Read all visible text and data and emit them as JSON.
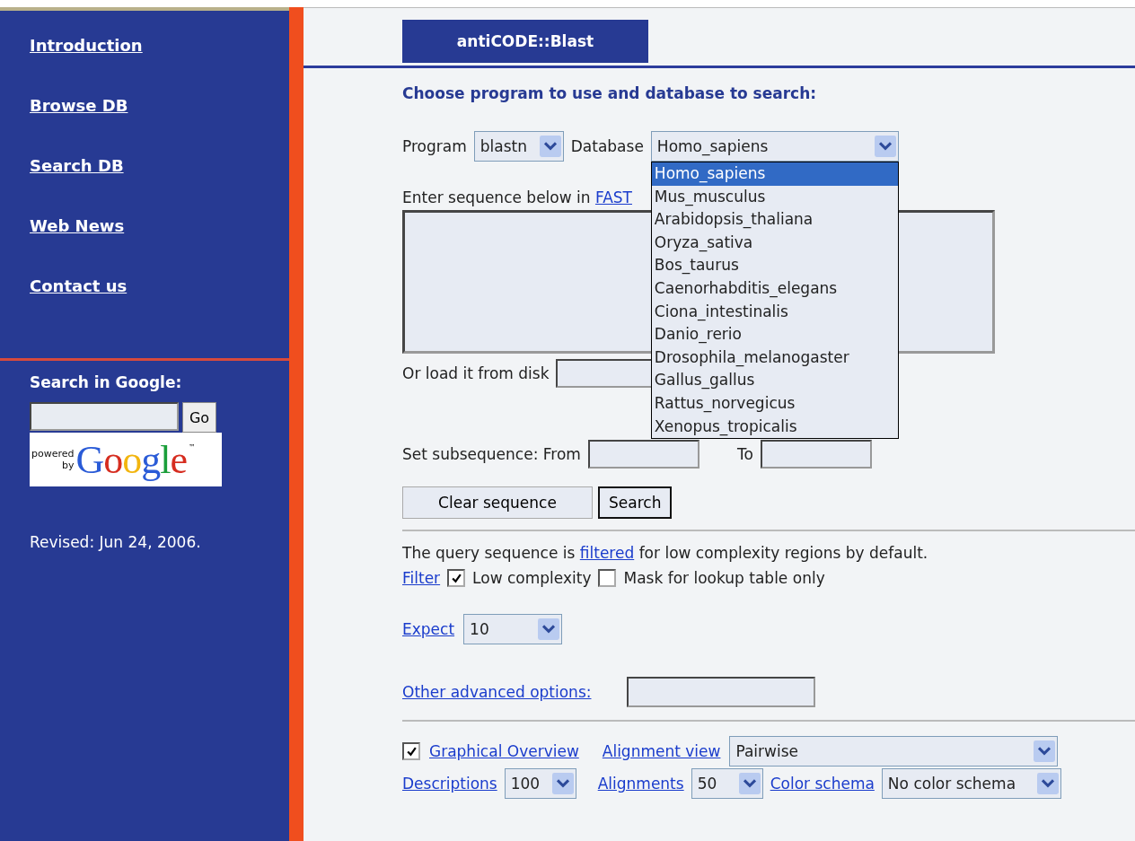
{
  "sidebar": {
    "nav_links": [
      "Introduction",
      "Browse DB",
      "Search DB",
      "Web News",
      "Contact us"
    ],
    "google": {
      "title": "Search in Google:",
      "button": "Go",
      "logo_small": [
        "powered",
        "by"
      ],
      "logo_word": "Google",
      "logo_mark": "™"
    },
    "revised": "Revised: Jun 24, 2006."
  },
  "tab": {
    "label": "antiCODE::Blast",
    "selected": true
  },
  "heading": "Choose program to use and database to search:",
  "program": {
    "label": "Program",
    "value": "blastn"
  },
  "database": {
    "label": "Database",
    "value": "Homo_sapiens",
    "expanded": true,
    "options": [
      {
        "label": "Homo_sapiens",
        "selected": true
      },
      {
        "label": "Mus_musculus",
        "selected": false
      },
      {
        "label": "Arabidopsis_thaliana",
        "selected": false
      },
      {
        "label": "Oryza_sativa",
        "selected": false
      },
      {
        "label": "Bos_taurus",
        "selected": false
      },
      {
        "label": "Caenorhabditis_elegans",
        "selected": false
      },
      {
        "label": "Ciona_intestinalis",
        "selected": false
      },
      {
        "label": "Danio_rerio",
        "selected": false
      },
      {
        "label": "Drosophila_melanogaster",
        "selected": false
      },
      {
        "label": "Gallus_gallus",
        "selected": false
      },
      {
        "label": "Rattus_norvegicus",
        "selected": false
      },
      {
        "label": "Xenopus_tropicalis",
        "selected": false
      }
    ]
  },
  "sequence": {
    "label": "Enter sequence below in",
    "link": "FAST"
  },
  "load": {
    "label": "Or load it from disk"
  },
  "subsequence": {
    "from_label": "Set subsequence: From",
    "to_label": "To"
  },
  "buttons": [
    {
      "label": "Clear sequence",
      "default": false
    },
    {
      "label": "Search",
      "default": true
    }
  ],
  "filter_note": {
    "before": "The query sequence is",
    "link": "filtered",
    "after": "for low complexity regions by default."
  },
  "filter": {
    "link": "Filter",
    "options": [
      {
        "label": "Low complexity",
        "checked": true
      },
      {
        "label": "Mask for lookup table only",
        "checked": false
      }
    ]
  },
  "expect": {
    "link": "Expect",
    "value": "10"
  },
  "advanced": {
    "link": "Other advanced options:"
  },
  "graphical": {
    "link": "Graphical Overview",
    "checked": true
  },
  "alignment_view": {
    "link": "Alignment view",
    "value": "Pairwise"
  },
  "descriptions": {
    "link": "Descriptions",
    "value": "100"
  },
  "alignments": {
    "link": "Alignments",
    "value": "50"
  },
  "color_schema": {
    "link": "Color schema",
    "value": "No color schema"
  }
}
